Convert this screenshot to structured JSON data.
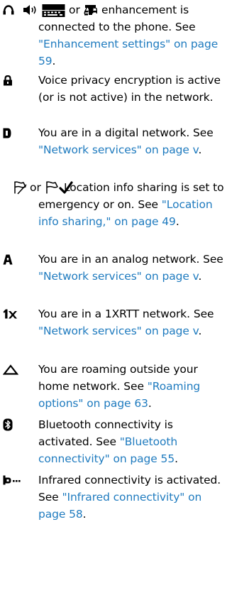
{
  "colors": {
    "text": "#000000",
    "link": "#1f7bbf",
    "background": "#ffffff"
  },
  "entries": [
    {
      "icons": [
        "headset-icon",
        "loudspeaker-icon",
        "tty-icon",
        "car-kit-icon"
      ],
      "or": "or",
      "desc": "An enhancement is connected to the phone. See",
      "link": "\"Enhancement settings\" on page 59",
      "end": "."
    },
    {
      "icons": [
        "lock-icon"
      ],
      "desc": "Voice privacy encryption is active (or is not active) in the network."
    },
    {
      "icons": [
        "digital-network-icon"
      ],
      "desc": "You are in a digital network. See",
      "link": "\"Network services\" on page v",
      "end": "."
    },
    {
      "icons": [
        "location-emergency-icon",
        "location-on-icon"
      ],
      "or": "or",
      "desc": "Location info sharing is set to emergency or on. See",
      "link": "\"Location info sharing,\" on page 49",
      "end": "."
    },
    {
      "icons": [
        "analog-network-icon"
      ],
      "desc": "You are in an analog network. See",
      "link": "\"Network services\" on page v",
      "end": "."
    },
    {
      "icons": [
        "1xrtt-network-icon"
      ],
      "desc": "You are in a 1XRTT network. See",
      "link": "\"Network services\" on page v",
      "end": "."
    },
    {
      "icons": [
        "roaming-icon"
      ],
      "desc": "You are roaming outside your home network. See",
      "link": "\"Roaming options\" on page 63",
      "end": "."
    },
    {
      "icons": [
        "bluetooth-icon"
      ],
      "desc": "Bluetooth connectivity is activated. See",
      "link": "\"Bluetooth connectivity\" on page 55",
      "end": "."
    },
    {
      "icons": [
        "infrared-icon"
      ],
      "desc": "Infrared connectivity is activated. See",
      "link": "\"Infrared connectivity\" on page 58",
      "end": "."
    }
  ]
}
